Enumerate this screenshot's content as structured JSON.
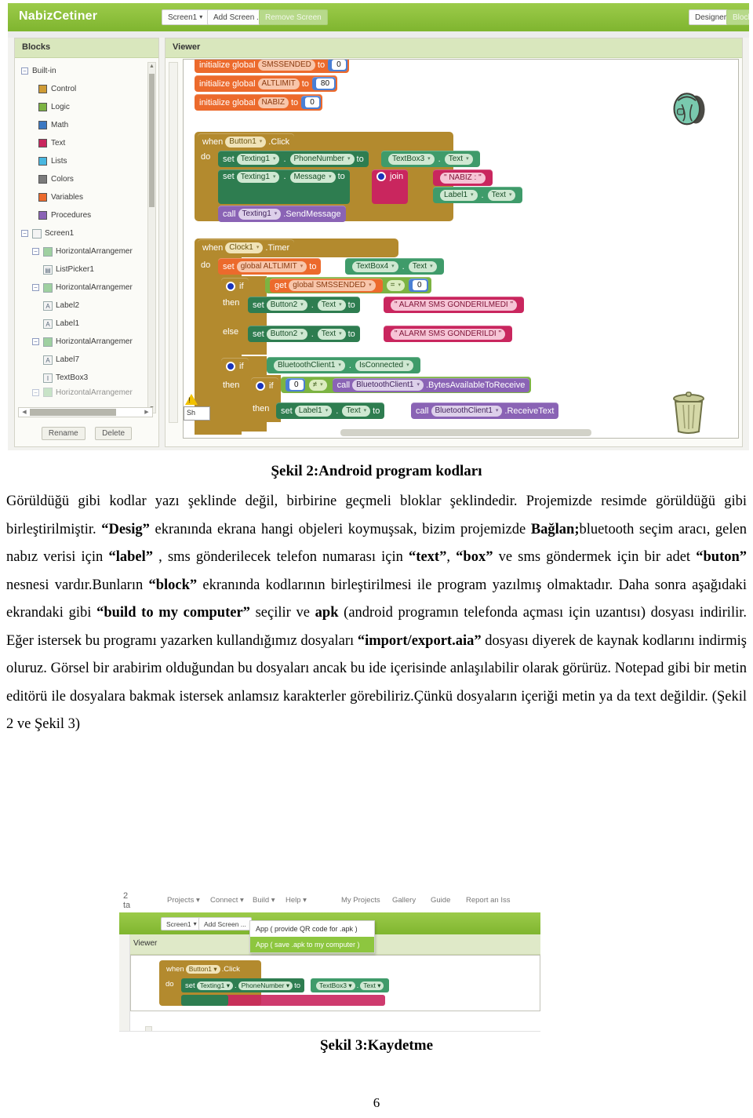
{
  "figure1": {
    "app_title": "NabizCetiner",
    "toolbar": {
      "screen_select": "Screen1",
      "add_screen": "Add Screen ...",
      "remove_screen": "Remove Screen",
      "designer": "Designer",
      "blocks": "Blocks"
    },
    "palette": {
      "title": "Blocks",
      "builtin_label": "Built-in",
      "builtin_items": [
        {
          "label": "Control",
          "color": "#cf9b35"
        },
        {
          "label": "Logic",
          "color": "#7cb342"
        },
        {
          "label": "Math",
          "color": "#3b78c2"
        },
        {
          "label": "Text",
          "color": "#c9265e"
        },
        {
          "label": "Lists",
          "color": "#49b7e0"
        },
        {
          "label": "Colors",
          "color": "#7b7b7b"
        },
        {
          "label": "Variables",
          "color": "#ec6a2c"
        },
        {
          "label": "Procedures",
          "color": "#8a63b5"
        }
      ],
      "screen_label": "Screen1",
      "tree_items": [
        "HorizontalArrangemer",
        "ListPicker1",
        "HorizontalArrangemer",
        "Label2",
        "Label1",
        "HorizontalArrangemer",
        "Label7",
        "TextBox3",
        "HorizontalArrangemer"
      ],
      "rename": "Rename",
      "delete": "Delete"
    },
    "viewer": {
      "title": "Viewer",
      "warning_button": "Sh"
    },
    "blocks": {
      "init_smssended": {
        "kw": "initialize global",
        "name": "SMSSENDED",
        "to": "to",
        "value": "0"
      },
      "init_altlimit": {
        "kw": "initialize global",
        "name": "ALTLIMIT",
        "to": "to",
        "value": "80"
      },
      "init_nabiz": {
        "kw": "initialize global",
        "name": "NABIZ",
        "to": "to",
        "value": "0"
      },
      "when_button1": {
        "when": "when",
        "component": "Button1",
        "event": ".Click",
        "do": "do"
      },
      "set_phone": {
        "set": "set",
        "component": "Texting1",
        "prop": "PhoneNumber",
        "to": "to",
        "val_comp": "TextBox3",
        "val_prop": "Text"
      },
      "set_message": {
        "set": "set",
        "component": "Texting1",
        "prop": "Message",
        "to": "to",
        "join": "join",
        "literal": "\" NABIZ : \"",
        "val_comp": "Label1",
        "val_prop": "Text"
      },
      "call_send": {
        "call": "call",
        "component": "Texting1",
        "method": ".SendMessage"
      },
      "when_clock": {
        "when": "when",
        "component": "Clock1",
        "event": ".Timer",
        "do": "do"
      },
      "set_altlimit": {
        "set": "set",
        "global": "global ALTLIMIT",
        "to": "to",
        "val_comp": "TextBox4",
        "val_prop": "Text"
      },
      "if_smssended": {
        "if": "if",
        "get": "get",
        "global": "global SMSSENDED",
        "op": "=",
        "value": "0"
      },
      "then_btn2_a": {
        "then": "then",
        "set": "set",
        "component": "Button2",
        "prop": "Text",
        "to": "to",
        "literal": "\" ALARM SMS GONDERILMEDI \""
      },
      "else_btn2_b": {
        "else": "else",
        "set": "set",
        "component": "Button2",
        "prop": "Text",
        "to": "to",
        "literal": "\" ALARM SMS GONDERILDI \""
      },
      "if_bt_connected": {
        "if": "if",
        "component": "BluetoothClient1",
        "prop": "IsConnected"
      },
      "then_if_bytes": {
        "then": "then",
        "if": "if",
        "value": "0",
        "op": "≠",
        "call": "call",
        "component": "BluetoothClient1",
        "method": ".BytesAvailableToReceive"
      },
      "then_set_label": {
        "then": "then",
        "set": "set",
        "component": "Label1",
        "prop": "Text",
        "to": "to",
        "call": "call",
        "bt": "BluetoothClient1",
        "method": ".ReceiveText"
      }
    },
    "icons": {
      "backpack": "backpack-icon",
      "trash": "trash-icon",
      "warning": "warning-icon"
    }
  },
  "captions": {
    "figure2": "Şekil 2:Android program kodları",
    "figure3": "Şekil 3:Kaydetme"
  },
  "body": {
    "p1_a": "Görüldüğü gibi kodlar yazı şeklinde değil, birbirine geçmeli bloklar şeklindedir. Projemizde resimde görüldüğü gibi birleştirilmiştir. ",
    "p1_desig": "“Desig”",
    "p1_b": " ekranında ekrana hangi objeleri koymuşsak, bizim projemizde ",
    "p1_baglan": "Bağlan;",
    "p1_c": "bluetooth seçim aracı, gelen nabız verisi için ",
    "p1_label": "“label”",
    "p1_d": " , sms gönderilecek telefon numarası için ",
    "p1_text": "“text”",
    "p1_e": ", ",
    "p1_box": "“box”",
    "p1_f": " ve sms göndermek için bir adet ",
    "p1_buton": "“buton”",
    "p1_g": " nesnesi vardır.Bunların ",
    "p1_block": "“block”",
    "p1_h": " ekranında kodlarının birleştirilmesi ile program yazılmış olmaktadır. Daha sonra aşağıdaki ekrandaki gibi ",
    "p1_build": "“build to my computer”",
    "p1_i": " seçilir ve ",
    "p1_apk": "apk",
    "p1_j": " (android programın telefonda açması için uzantısı) dosyası indirilir. Eğer istersek bu programı yazarken kullandığımız dosyaları ",
    "p1_import": "“import/export.aia”",
    "p1_k": " dosyası diyerek de kaynak kodlarını indirmiş oluruz. Görsel bir arabirim olduğundan bu dosyaları ancak bu ide içerisinde anlaşılabilir olarak görürüz. Notepad gibi bir metin editörü ile dosyalara bakmak istersek anlamsız karakterler görebiliriz.Çünkü dosyaların içeriği metin ya da text değildir. (Şekil 2 ve Şekil 3)"
  },
  "figure3": {
    "corner_text_top": "2",
    "corner_text_bottom": "ta",
    "menu": [
      {
        "label": "Projects",
        "caret": true
      },
      {
        "label": "Connect",
        "caret": true
      },
      {
        "label": "Build",
        "caret": true
      },
      {
        "label": "Help",
        "caret": true
      },
      {
        "label": "My Projects",
        "caret": false
      },
      {
        "label": "Gallery",
        "caret": false
      },
      {
        "label": "Guide",
        "caret": false
      },
      {
        "label": "Report an Iss",
        "caret": false
      }
    ],
    "screen_select": "Screen1",
    "add_screen": "Add Screen ...",
    "dropdown": [
      "App ( provide QR code for .apk )",
      "App ( save .apk to my computer )"
    ],
    "dropdown_selected_index": 1,
    "viewer_label": "Viewer",
    "blocks": {
      "when_button1": {
        "when": "when",
        "component": "Button1",
        "event": ".Click",
        "do": "do"
      },
      "set_phone": {
        "set": "set",
        "component": "Texting1",
        "prop": "PhoneNumber",
        "to": "to",
        "val_comp": "TextBox3",
        "val_prop": "Text"
      }
    }
  },
  "page_number": "6"
}
